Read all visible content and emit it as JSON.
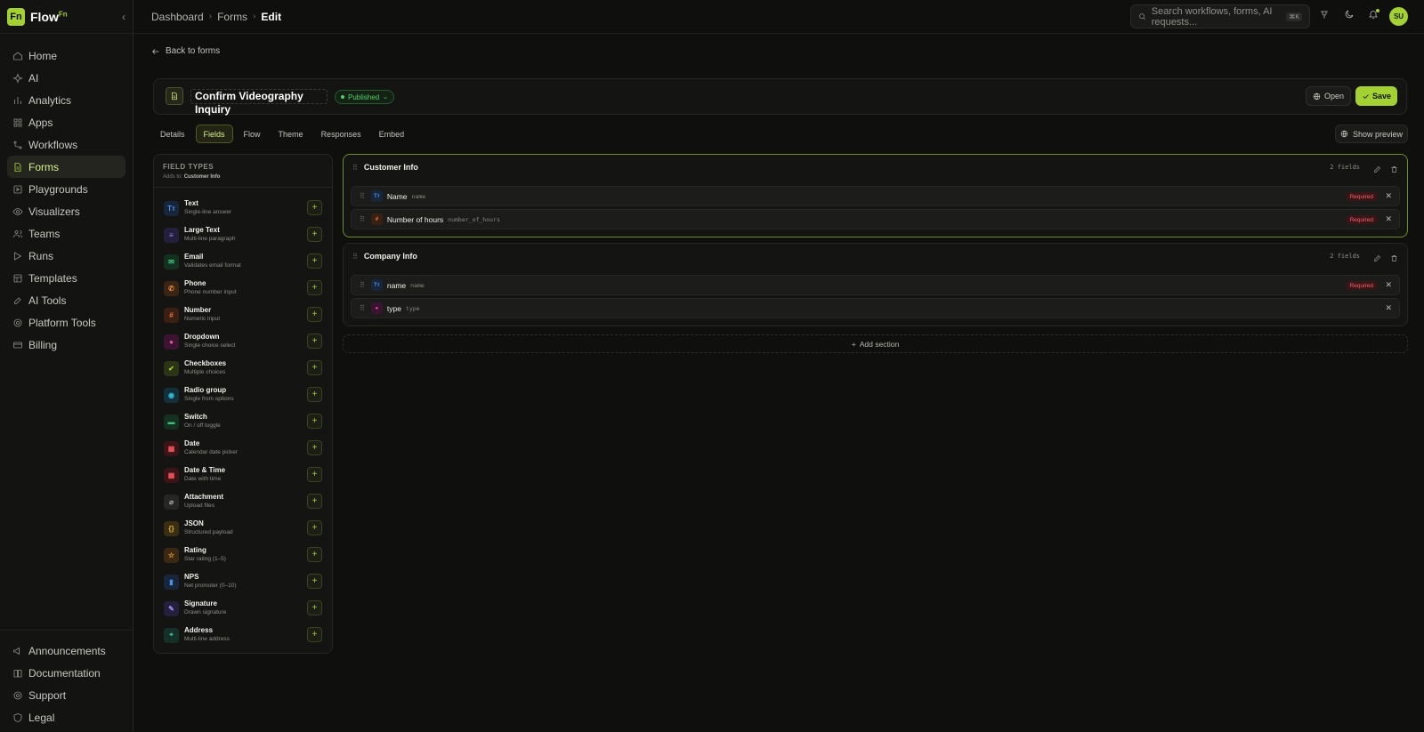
{
  "app": {
    "logo_mark": "Fn",
    "name": "Flow",
    "name_sup": "Fn",
    "collapse_icon": "chevron-left-icon"
  },
  "nav": {
    "items": [
      {
        "label": "Home",
        "icon": "home-icon"
      },
      {
        "label": "AI",
        "icon": "sparkle-icon"
      },
      {
        "label": "Analytics",
        "icon": "bar-chart-icon"
      },
      {
        "label": "Apps",
        "icon": "grid-icon"
      },
      {
        "label": "Workflows",
        "icon": "workflow-icon"
      },
      {
        "label": "Forms",
        "icon": "form-icon",
        "active": true
      },
      {
        "label": "Playgrounds",
        "icon": "playground-icon"
      },
      {
        "label": "Visualizers",
        "icon": "eye-icon"
      },
      {
        "label": "Teams",
        "icon": "users-icon"
      },
      {
        "label": "Runs",
        "icon": "runs-icon"
      },
      {
        "label": "Templates",
        "icon": "template-icon"
      },
      {
        "label": "AI Tools",
        "icon": "ai-tools-icon"
      },
      {
        "label": "Platform Tools",
        "icon": "platform-tools-icon"
      },
      {
        "label": "Billing",
        "icon": "billing-icon"
      }
    ],
    "bottom": [
      {
        "label": "Announcements",
        "icon": "megaphone-icon"
      },
      {
        "label": "Documentation",
        "icon": "book-icon"
      },
      {
        "label": "Support",
        "icon": "support-icon"
      },
      {
        "label": "Legal",
        "icon": "shield-icon"
      }
    ]
  },
  "breadcrumb": [
    "Dashboard",
    "Forms",
    "Edit"
  ],
  "search": {
    "placeholder": "Search workflows, forms, AI requests...",
    "shortcut": "⌘K"
  },
  "user": {
    "initials": "SU"
  },
  "back_label": "Back to forms",
  "form": {
    "title": "Confirm Videography Inquiry",
    "status": "Published",
    "open_label": "Open",
    "save_label": "Save"
  },
  "tabs": [
    "Details",
    "Fields",
    "Flow",
    "Theme",
    "Responses",
    "Embed"
  ],
  "active_tab": "Fields",
  "show_preview_label": "Show preview",
  "field_types": {
    "title": "FIELD TYPES",
    "adds_to_prefix": "Adds to:",
    "adds_to": "Customer Info",
    "items": [
      {
        "name": "Text",
        "desc": "Single-line answer",
        "glyph": "Tт",
        "color": "#4f8ee6",
        "bg": "#17263b"
      },
      {
        "name": "Large Text",
        "desc": "Multi-line paragraph",
        "glyph": "≡",
        "color": "#9b8cf0",
        "bg": "#241f3b"
      },
      {
        "name": "Email",
        "desc": "Validates email format",
        "glyph": "✉",
        "color": "#3fbf7f",
        "bg": "#14301f"
      },
      {
        "name": "Phone",
        "desc": "Phone number input",
        "glyph": "✆",
        "color": "#f08c3a",
        "bg": "#3a2413"
      },
      {
        "name": "Number",
        "desc": "Numeric input",
        "glyph": "#",
        "color": "#f07a3a",
        "bg": "#3a2013"
      },
      {
        "name": "Dropdown",
        "desc": "Single choice select",
        "glyph": "●",
        "color": "#e857a6",
        "bg": "#3a1430"
      },
      {
        "name": "Checkboxes",
        "desc": "Multiple choices",
        "glyph": "✔",
        "color": "#a3d134",
        "bg": "#2b3515"
      },
      {
        "name": "Radio group",
        "desc": "Single from options",
        "glyph": "◉",
        "color": "#35b6d6",
        "bg": "#12303a"
      },
      {
        "name": "Switch",
        "desc": "On / off toggle",
        "glyph": "▬",
        "color": "#3fbf7f",
        "bg": "#14301f"
      },
      {
        "name": "Date",
        "desc": "Calendar date picker",
        "glyph": "▦",
        "color": "#f0575c",
        "bg": "#3a1416"
      },
      {
        "name": "Date & Time",
        "desc": "Date with time",
        "glyph": "▦",
        "color": "#f0575c",
        "bg": "#3a1416"
      },
      {
        "name": "Attachment",
        "desc": "Upload files",
        "glyph": "⌀",
        "color": "#a8a8a2",
        "bg": "#262624"
      },
      {
        "name": "JSON",
        "desc": "Structured payload",
        "glyph": "{}",
        "color": "#e0b43a",
        "bg": "#3a2f13"
      },
      {
        "name": "Rating",
        "desc": "Star rating (1–5)",
        "glyph": "☆",
        "color": "#f0a03a",
        "bg": "#3a2813"
      },
      {
        "name": "NPS",
        "desc": "Net promoter (0–10)",
        "glyph": "▮",
        "color": "#4f8ee6",
        "bg": "#17263b"
      },
      {
        "name": "Signature",
        "desc": "Drawn signature",
        "glyph": "✎",
        "color": "#9b8cf0",
        "bg": "#241f3b"
      },
      {
        "name": "Address",
        "desc": "Multi-line address",
        "glyph": "⌖",
        "color": "#3fbf9f",
        "bg": "#143028"
      }
    ]
  },
  "sections": [
    {
      "title": "Customer Info",
      "count": "2 fields",
      "selected": true,
      "fields": [
        {
          "label": "Name",
          "key": "name",
          "glyph": "Tт",
          "color": "#4f8ee6",
          "bg": "#17263b",
          "required": "Required"
        },
        {
          "label": "Number of hours",
          "key": "number_of_hours",
          "glyph": "#",
          "color": "#f07a3a",
          "bg": "#3a2013",
          "required": "Required"
        }
      ]
    },
    {
      "title": "Company Info",
      "count": "2 fields",
      "selected": false,
      "fields": [
        {
          "label": "name",
          "key": "name",
          "glyph": "Tт",
          "color": "#4f8ee6",
          "bg": "#17263b",
          "required": "Required"
        },
        {
          "label": "type",
          "key": "type",
          "glyph": "●",
          "color": "#e857a6",
          "bg": "#3a1430",
          "required": ""
        }
      ]
    }
  ],
  "add_section_label": "Add section",
  "colors": {
    "accent": "#a3d134",
    "background": "#0f0f0e",
    "danger": "#f0646a",
    "success": "#4fd168"
  }
}
